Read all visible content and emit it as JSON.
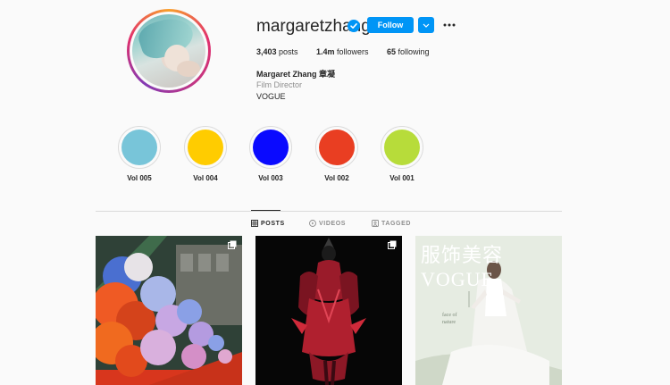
{
  "profile": {
    "username": "margaretzhang",
    "follow_label": "Follow",
    "stats": {
      "posts": {
        "value": "3,403",
        "label": "posts"
      },
      "followers": {
        "value": "1.4m",
        "label": "followers"
      },
      "following": {
        "value": "65",
        "label": "following"
      }
    },
    "full_name": "Margaret Zhang 章凝",
    "category": "Film Director",
    "bio": "VOGUE"
  },
  "highlights": [
    {
      "label": "Vol 005",
      "color": "#78c5d9"
    },
    {
      "label": "Vol 004",
      "color": "#ffcc00"
    },
    {
      "label": "Vol 003",
      "color": "#0a0aff"
    },
    {
      "label": "Vol 002",
      "color": "#e93e22"
    },
    {
      "label": "Vol 001",
      "color": "#b7dc3a"
    }
  ],
  "tabs": [
    {
      "label": "POSTS",
      "icon": "grid-icon",
      "active": true
    },
    {
      "label": "VIDEOS",
      "icon": "play-icon",
      "active": false
    },
    {
      "label": "TAGGED",
      "icon": "tag-icon",
      "active": false
    }
  ],
  "posts": [
    {
      "kind": "floral-installation",
      "multi": true
    },
    {
      "kind": "red-gown-dark",
      "multi": true
    },
    {
      "kind": "vogue-cover",
      "cover_title": "服饰美容 VOGUE",
      "multi": false
    }
  ],
  "colors": {
    "accent": "#0095f6",
    "text": "#262626",
    "muted": "#8e8e8e"
  }
}
